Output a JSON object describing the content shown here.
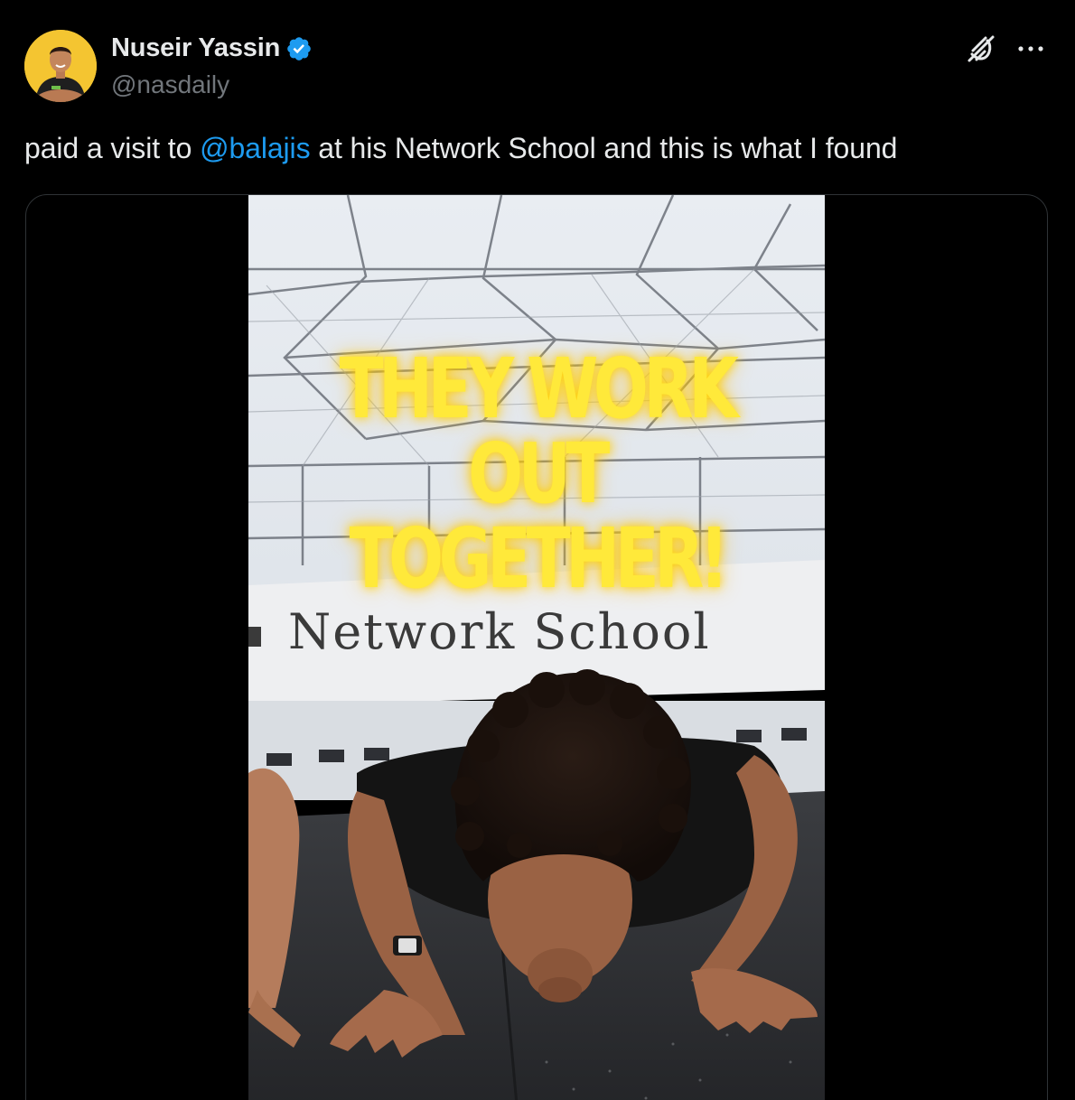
{
  "author": {
    "display_name": "Nuseir Yassin",
    "handle": "@nasdaily",
    "verified": true
  },
  "tweet": {
    "text_before": "paid a visit to ",
    "mention": "@balajis",
    "text_after": " at his Network School and this is what I found"
  },
  "media": {
    "overlay_caption": "THEY WORK OUT\nTOGETHER!",
    "banner_text": "Network School"
  },
  "icons": {
    "verified": "verified-badge-icon",
    "grok": "grok-icon",
    "more": "more-options-icon"
  },
  "colors": {
    "background": "#000000",
    "text": "#e7e9ea",
    "secondary_text": "#71767b",
    "link": "#1d9bf0",
    "verified": "#1d9bf0",
    "caption": "#ffe93a",
    "avatar_background": "#f4c531"
  }
}
